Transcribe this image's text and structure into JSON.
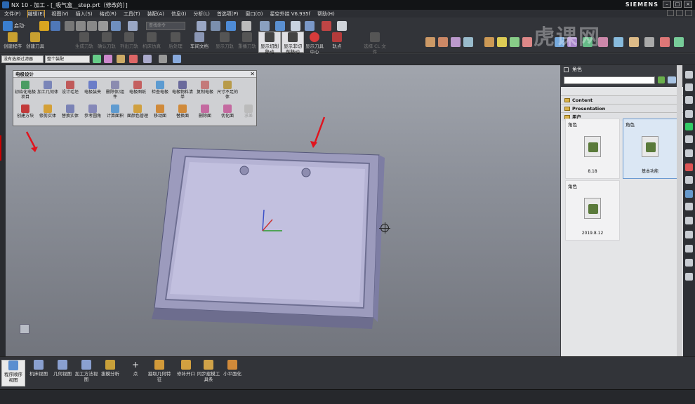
{
  "title": "NX 10 - 加工 - [_吸气盒__step.prt（修改的）]",
  "brand": "SIEMENS",
  "menu": [
    "文件(F)",
    "编辑(E)",
    "视图(V)",
    "插入(S)",
    "格式(R)",
    "工具(T)",
    "装配(A)",
    "信息(I)",
    "分析(L)",
    "首选项(P)",
    "窗口(O)",
    "星空外挂 V6.935f",
    "帮助(H)"
  ],
  "toolbar": {
    "start_label": "启动·",
    "search_placeholder": "查找命令",
    "big_buttons": [
      "创建程序",
      "创建刀具",
      "生成刀轨",
      "确认刀轨",
      "列出刀轨",
      "机床仿真",
      "后处理",
      "车间文档",
      "显示刀轨",
      "重播刀轨",
      "显示切削移动",
      "显示非切削移动",
      "显示刀具中心",
      "轨点",
      "选择 CL 文件"
    ]
  },
  "filters": {
    "type": "没有选择过滤器",
    "scope": "整个装配"
  },
  "palette": {
    "title": "电极设计",
    "row1": [
      "初始化电极项目",
      "加工几何体",
      "设计毛坯",
      "电极装夹",
      "删除体/组件",
      "电极图纸",
      "检查电极",
      "电极物料清单",
      "复制电极",
      "尺寸不足的体"
    ],
    "row2": [
      "创建方块",
      "修剪实体",
      "替换实体",
      "参考圆角",
      "计算面积",
      "面颜色管理",
      "移动面",
      "替换面",
      "删除面",
      "优化面",
      "求差"
    ]
  },
  "right_panel": {
    "title": "角色",
    "sections": [
      "Content",
      "Presentation",
      "用户"
    ],
    "cards": [
      {
        "title": "角色",
        "label": "8.18"
      },
      {
        "title": "角色",
        "label": "基本功能"
      },
      {
        "title": "角色",
        "label": "2019.8.12"
      }
    ]
  },
  "bottom": [
    "程序顺序视图",
    "机床视图",
    "几何视图",
    "加工方法视图",
    "拔模分析",
    "点",
    "抽取几何特征",
    "修补开口",
    "同步建模工具条",
    "小平面化"
  ],
  "watermark": "虎课网",
  "colors": {
    "accent_red": "#e0141e",
    "selected_card": "#dbe7f4",
    "panel_bg": "#e4e5e7"
  }
}
